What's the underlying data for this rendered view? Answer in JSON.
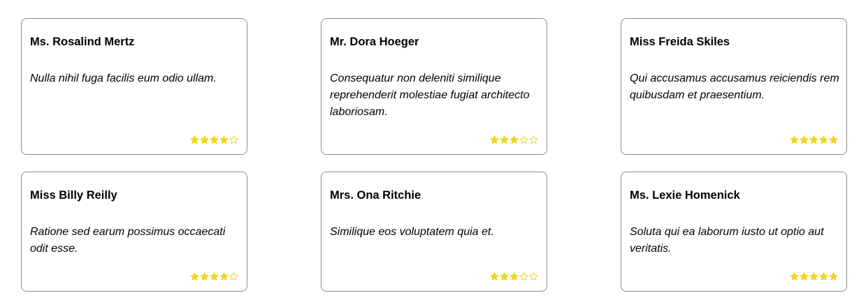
{
  "colors": {
    "star": "#f2d41d",
    "border": "#8c8c8c",
    "text": "#000000"
  },
  "star_max": 5,
  "reviews": [
    {
      "name": "Ms. Rosalind Mertz",
      "quote": "Nulla nihil fuga facilis eum odio ullam.",
      "rating": 4
    },
    {
      "name": "Mr. Dora Hoeger",
      "quote": "Consequatur non deleniti similique reprehenderit molestiae fugiat architecto laboriosam.",
      "rating": 3
    },
    {
      "name": "Miss Freida Skiles",
      "quote": "Qui accusamus accusamus reiciendis rem quibusdam et praesentium.",
      "rating": 5
    },
    {
      "name": "Miss Billy Reilly",
      "quote": "Ratione sed earum possimus occaecati odit esse.",
      "rating": 4
    },
    {
      "name": "Mrs. Ona Ritchie",
      "quote": "Similique eos voluptatem quia et.",
      "rating": 3
    },
    {
      "name": "Ms. Lexie Homenick",
      "quote": "Soluta qui ea laborum iusto ut optio aut veritatis.",
      "rating": 5
    }
  ]
}
